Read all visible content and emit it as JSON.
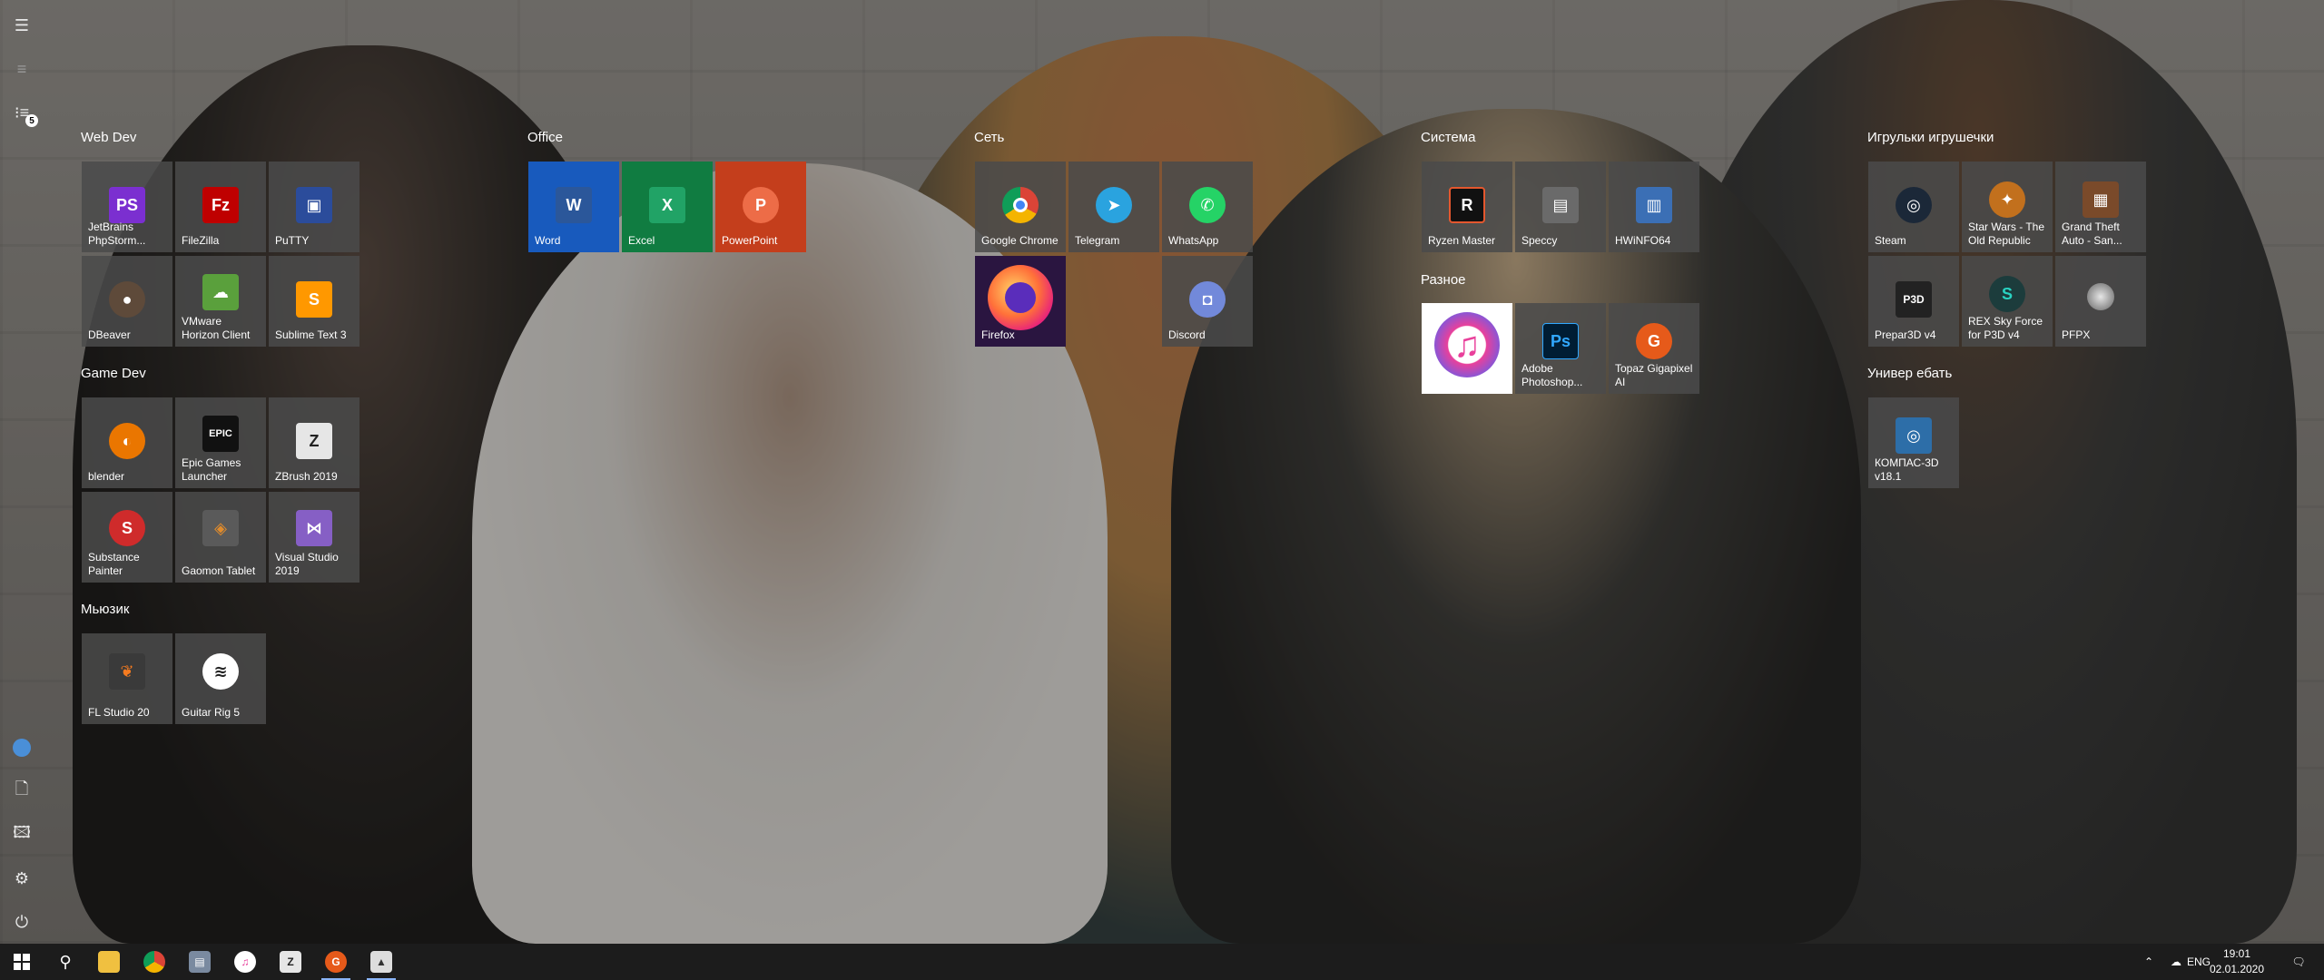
{
  "rail": {
    "menu_icon": "hamburger-icon",
    "all_apps_icon": "list-icon",
    "badge_count": "5"
  },
  "groups": {
    "webdev": {
      "title": "Web Dev",
      "tiles": [
        {
          "label": "JetBrains\nPhpStorm...",
          "glyph": "PS",
          "color": "#7b2fd0"
        },
        {
          "label": "FileZilla",
          "glyph": "Fz",
          "color": "#bf0000"
        },
        {
          "label": "PuTTY",
          "glyph": "▣",
          "color": "#2b4c9b"
        },
        {
          "label": "DBeaver",
          "glyph": "●",
          "color": "#5e4a3a"
        },
        {
          "label": "VMware\nHorizon Client",
          "glyph": "☁",
          "color": "#5aa03c"
        },
        {
          "label": "Sublime Text 3",
          "glyph": "S",
          "color": "#ff9800"
        }
      ]
    },
    "office": {
      "title": "Office",
      "tiles": [
        {
          "label": "Word",
          "glyph": "W",
          "color": "#2b579a",
          "bg": "#185abd"
        },
        {
          "label": "Excel",
          "glyph": "X",
          "color": "#21a366",
          "bg": "#107c41"
        },
        {
          "label": "PowerPoint",
          "glyph": "P",
          "color": "#ed6c47",
          "bg": "#c43e1c"
        }
      ]
    },
    "network": {
      "title": "Сеть",
      "tiles": [
        {
          "label": "Google Chrome",
          "glyph": "◉",
          "color": "#dd4b39"
        },
        {
          "label": "Telegram",
          "glyph": "➤",
          "color": "#2aa3df"
        },
        {
          "label": "WhatsApp",
          "glyph": "✆",
          "color": "#25d366"
        },
        {
          "label": "Firefox",
          "glyph": "◕",
          "color": "#ff7139",
          "bg": "#2a1540"
        },
        {
          "label": "Discord",
          "glyph": "◘",
          "color": "#7289da"
        }
      ]
    },
    "system": {
      "title": "Система",
      "tiles": [
        {
          "label": "Ryzen Master",
          "glyph": "R",
          "color": "#111111"
        },
        {
          "label": "Speccy",
          "glyph": "▤",
          "color": "#6a6a6a"
        },
        {
          "label": "HWiNFO64",
          "glyph": "▥",
          "color": "#3b6fb5"
        }
      ]
    },
    "misc": {
      "title": "Разное",
      "tiles": [
        {
          "label": "",
          "glyph": "♫",
          "color": "#e9409b",
          "bg": "#ffffff"
        },
        {
          "label": "Adobe\nPhotoshop...",
          "glyph": "Ps",
          "color": "#001d34"
        },
        {
          "label": "Topaz Gigapixel\nAI",
          "glyph": "G",
          "color": "#e65a1a"
        }
      ]
    },
    "games": {
      "title": "Игрульки игрушечки",
      "tiles": [
        {
          "label": "Steam",
          "glyph": "◎",
          "color": "#1b2838"
        },
        {
          "label": "Star Wars - The\nOld Republic",
          "glyph": "✦",
          "color": "#c2701d"
        },
        {
          "label": "Grand Theft\nAuto - San...",
          "glyph": "▦",
          "color": "#7a4a2a"
        },
        {
          "label": "Prepar3D v4",
          "glyph": "P3D",
          "color": "#222222"
        },
        {
          "label": "REX Sky Force\nfor P3D v4",
          "glyph": "S",
          "color": "#1c3c3c"
        },
        {
          "label": "PFPX",
          "glyph": "◍",
          "color": "#8a8a8a"
        }
      ]
    },
    "univer": {
      "title": "Универ ебать",
      "tiles": [
        {
          "label": "КОМПАС-3D\nv18.1",
          "glyph": "◎",
          "color": "#2d6ea8"
        }
      ]
    },
    "gamedev": {
      "title": "Game Dev",
      "tiles": [
        {
          "label": "blender",
          "glyph": "◐",
          "color": "#ea7600"
        },
        {
          "label": "Epic Games\nLauncher",
          "glyph": "EPIC",
          "color": "#111111"
        },
        {
          "label": "ZBrush 2019",
          "glyph": "Z",
          "color": "#e6e6e6"
        },
        {
          "label": "Substance\nPainter",
          "glyph": "S",
          "color": "#cf2b2b"
        },
        {
          "label": "Gaomon Tablet",
          "glyph": "◈",
          "color": "#e08b2c"
        },
        {
          "label": "Visual Studio\n2019",
          "glyph": "⋈",
          "color": "#865fc5"
        }
      ]
    },
    "music": {
      "title": "Мьюзик",
      "tiles": [
        {
          "label": "FL Studio 20",
          "glyph": "❦",
          "color": "#f57b20"
        },
        {
          "label": "Guitar Rig 5",
          "glyph": "≋",
          "color": "#222222"
        }
      ]
    }
  },
  "taskbar": {
    "language": "ENG",
    "time": "19:01",
    "date": "02.01.2020"
  }
}
